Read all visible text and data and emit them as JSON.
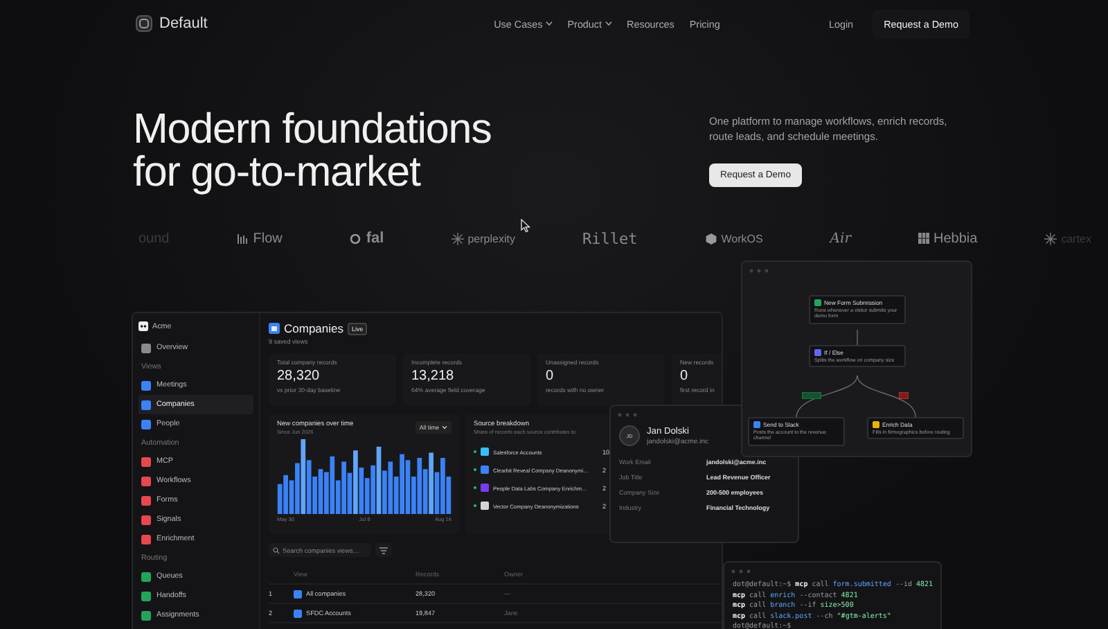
{
  "nav": {
    "brand": "Default",
    "links": [
      {
        "label": "Use Cases",
        "dropdown": true
      },
      {
        "label": "Product",
        "dropdown": true
      },
      {
        "label": "Resources",
        "dropdown": false
      },
      {
        "label": "Pricing",
        "dropdown": false
      }
    ],
    "login": "Login",
    "cta": "Request a Demo"
  },
  "hero": {
    "title_lines": [
      "Modern foundations",
      "for go-to-market"
    ],
    "subtitle": "One platform to manage workflows, enrich records, route leads, and schedule meetings.",
    "cta": "Request a Demo"
  },
  "logos": [
    {
      "kind": "text",
      "label": "ound",
      "faded": true
    },
    {
      "kind": "bars",
      "label": "Flow",
      "faded": false
    },
    {
      "kind": "ring",
      "label": "fal",
      "faded": false
    },
    {
      "kind": "burst",
      "label": "perplexity",
      "faded": false
    },
    {
      "kind": "mono",
      "label": "Rillet",
      "faded": false
    },
    {
      "kind": "hex",
      "label": "WorkOS",
      "faded": false
    },
    {
      "kind": "script",
      "label": "Air",
      "faded": false
    },
    {
      "kind": "grid",
      "label": "Hebbia",
      "faded": false
    },
    {
      "kind": "burst",
      "label": "cartex",
      "faded": true
    }
  ],
  "dashboard": {
    "workspace": "Acme",
    "sidebar": [
      {
        "kind": "item",
        "label": "Overview",
        "color": "#8a8a8f",
        "selected": false
      },
      {
        "kind": "section",
        "label": "Views"
      },
      {
        "kind": "item",
        "label": "Meetings",
        "color": "#3b82f6",
        "selected": false
      },
      {
        "kind": "item",
        "label": "Companies",
        "color": "#3b82f6",
        "selected": true
      },
      {
        "kind": "item",
        "label": "People",
        "color": "#3b82f6",
        "selected": false
      },
      {
        "kind": "section",
        "label": "Automation"
      },
      {
        "kind": "item",
        "label": "MCP",
        "color": "#e5484d",
        "selected": false
      },
      {
        "kind": "item",
        "label": "Workflows",
        "color": "#e5484d",
        "selected": false
      },
      {
        "kind": "item",
        "label": "Forms",
        "color": "#e5484d",
        "selected": false
      },
      {
        "kind": "item",
        "label": "Signals",
        "color": "#e5484d",
        "selected": false
      },
      {
        "kind": "item",
        "label": "Enrichment",
        "color": "#e5484d",
        "selected": false
      },
      {
        "kind": "section",
        "label": "Routing"
      },
      {
        "kind": "item",
        "label": "Queues",
        "color": "#22a55b",
        "selected": false
      },
      {
        "kind": "item",
        "label": "Handoffs",
        "color": "#22a55b",
        "selected": false
      },
      {
        "kind": "item",
        "label": "Assignments",
        "color": "#22a55b",
        "selected": false
      }
    ],
    "title": "Companies",
    "badge": "Live",
    "subtitle": "9 saved views",
    "stats": [
      {
        "label": "Total company records",
        "value": "28,320",
        "note": "vs prior 30-day baseline"
      },
      {
        "label": "Incomplete records",
        "value": "13,218",
        "note": "64% average field coverage"
      },
      {
        "label": "Unassigned records",
        "value": "0",
        "note": "records with no owner"
      },
      {
        "label": "New records",
        "value": "0",
        "note": "first record in"
      }
    ],
    "chart": {
      "title": "New companies over time",
      "subtitle": "Since Jun 2026",
      "range": "All time",
      "x_labels": [
        "May 30",
        "Jul 8",
        "Aug 16"
      ]
    },
    "sources": {
      "title": "Source breakdown",
      "subtitle": "Share of records each source contributes to",
      "rows": [
        {
          "label": "Salesforce Accounts",
          "color": "#38bdf8",
          "value": "10"
        },
        {
          "label": "Clearbit Reveal Company Deanonymi…",
          "color": "#3b82f6",
          "value": "2"
        },
        {
          "label": "People Data Labs Company Enrichm…",
          "color": "#7c3aed",
          "value": "2"
        },
        {
          "label": "Vector Company Deanonymizations",
          "color": "#d4d4d8",
          "value": "2"
        }
      ]
    },
    "search_placeholder": "Search companies views…",
    "table": {
      "columns": [
        "View",
        "Records",
        "Owner"
      ],
      "rows": [
        {
          "index": "1",
          "view": "All companies",
          "records": "28,320",
          "owner": "—"
        },
        {
          "index": "2",
          "view": "SFDC Accounts",
          "records": "19,847",
          "owner": "Jane"
        }
      ]
    }
  },
  "workflow": {
    "nodes": [
      {
        "kind": "trigger",
        "title": "New Form Submission",
        "text": "Runs whenever a visitor submits your demo form"
      },
      {
        "kind": "branch",
        "title": "If / Else",
        "text": "Splits the workflow on company size"
      },
      {
        "kind": "action",
        "title": "Send to Slack",
        "text": "Posts the account to the revenue channel"
      },
      {
        "kind": "enrich",
        "title": "Enrich Data",
        "text": "Fills in firmographics before routing"
      }
    ]
  },
  "contact": {
    "initials": "JD",
    "name": "Jan Dolski",
    "email": "jandolski@acme.inc",
    "fields": [
      {
        "label": "Work Email",
        "value": "jandolski@acme.inc"
      },
      {
        "label": "Job Title",
        "value": "Lead Revenue Officer"
      },
      {
        "label": "Company Size",
        "value": "200-500 employees"
      },
      {
        "label": "Industry",
        "value": "Financial Technology"
      }
    ]
  },
  "terminal": {
    "lines": [
      [
        {
          "kind": "prompt",
          "text": "dot@default:~$"
        },
        {
          "kind": "cmd",
          "text": "mcp"
        },
        {
          "kind": "plain",
          "text": "call"
        },
        {
          "kind": "fn",
          "text": "form.submitted"
        },
        {
          "kind": "flag",
          "text": "--id"
        },
        {
          "kind": "num",
          "text": "4821"
        }
      ],
      [
        {
          "kind": "cmd",
          "text": "mcp"
        },
        {
          "kind": "plain",
          "text": "call"
        },
        {
          "kind": "fn",
          "text": "enrich"
        },
        {
          "kind": "flag",
          "text": "--contact"
        },
        {
          "kind": "num",
          "text": "4821"
        }
      ],
      [
        {
          "kind": "cmd",
          "text": "mcp"
        },
        {
          "kind": "plain",
          "text": "call"
        },
        {
          "kind": "fn",
          "text": "branch"
        },
        {
          "kind": "flag",
          "text": "--if"
        },
        {
          "kind": "num",
          "text": "size>500"
        }
      ],
      [
        {
          "kind": "cmd",
          "text": "mcp"
        },
        {
          "kind": "plain",
          "text": "call"
        },
        {
          "kind": "fn",
          "text": "slack.post"
        },
        {
          "kind": "flag",
          "text": "--ch"
        },
        {
          "kind": "num",
          "text": "\"#gtm-alerts\""
        }
      ],
      [
        {
          "kind": "prompt",
          "text": "dot@default:~$"
        }
      ]
    ]
  }
}
